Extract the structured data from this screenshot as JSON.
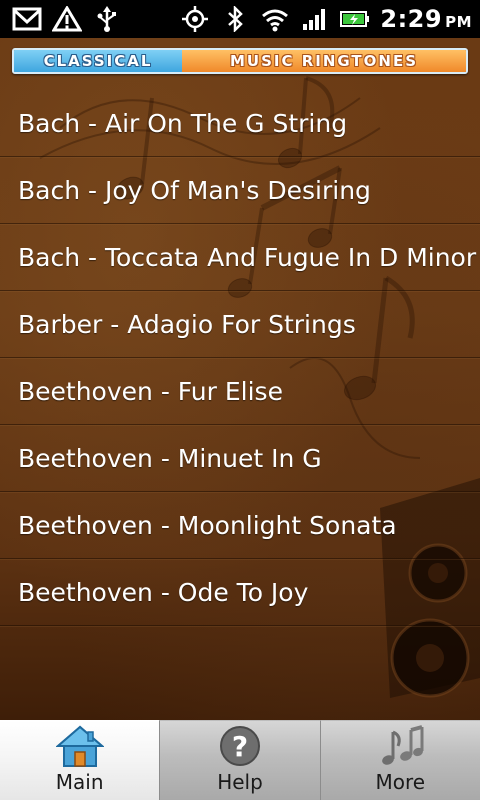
{
  "status_bar": {
    "time": "2:29",
    "ampm": "PM",
    "icons": [
      "gmail-icon",
      "warning-icon",
      "usb-icon",
      "gps-icon",
      "bluetooth-icon",
      "wifi-icon",
      "signal-icon",
      "battery-icon"
    ]
  },
  "banner": {
    "part1": "Classical",
    "part2": "Music Ringtones"
  },
  "ringtones": [
    "Bach - Air On The G String",
    "Bach - Joy Of Man's Desiring",
    "Bach - Toccata And Fugue In D Minor",
    "Barber - Adagio For Strings",
    "Beethoven - Fur Elise",
    "Beethoven - Minuet In G",
    "Beethoven - Moonlight Sonata",
    "Beethoven - Ode To Joy"
  ],
  "tabs": [
    {
      "label": "Main",
      "icon": "home-icon",
      "active": true
    },
    {
      "label": "Help",
      "icon": "help-icon",
      "active": false
    },
    {
      "label": "More",
      "icon": "music-notes-icon",
      "active": false
    }
  ],
  "colors": {
    "background": "#6a3a14",
    "banner_blue": "#3fa6df",
    "banner_orange": "#f0892a",
    "battery_green": "#3cc63c"
  }
}
